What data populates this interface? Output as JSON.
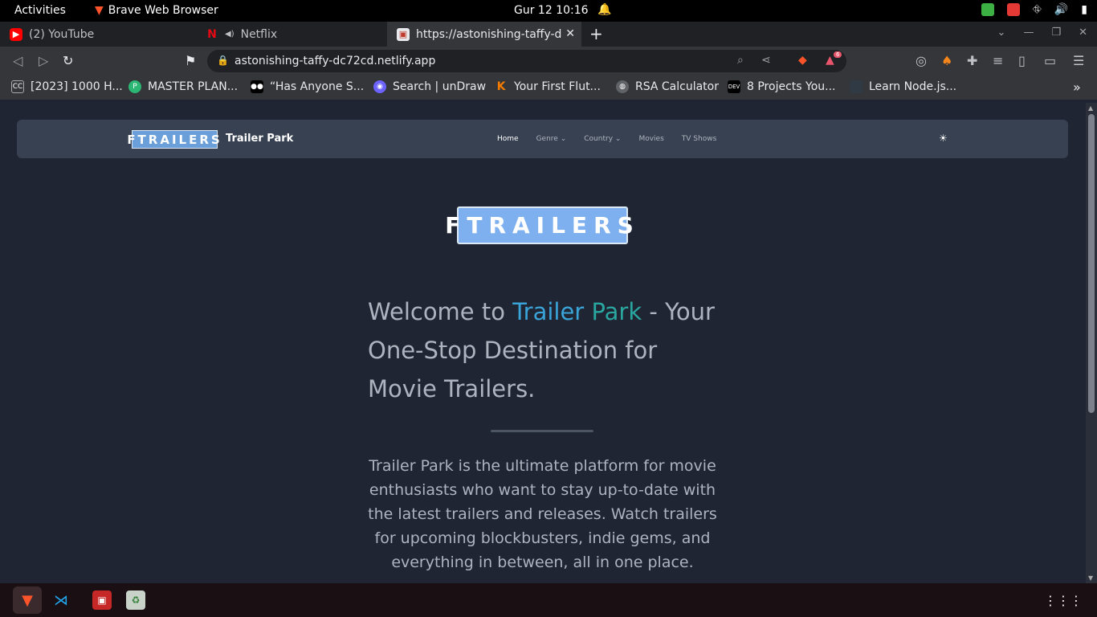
{
  "system": {
    "activities": "Activities",
    "app_name": "Brave Web Browser",
    "clock": "Gur 12  10:16"
  },
  "tabs": [
    {
      "label": "(2) YouTube"
    },
    {
      "label": "Netflix"
    },
    {
      "label": "https://astonishing-taffy-d"
    }
  ],
  "toolbar": {
    "url": "astonishing-taffy-dc72cd.netlify.app",
    "rewards_badge": "6"
  },
  "bookmarks": [
    {
      "label": "[2023] 1000 H..."
    },
    {
      "label": "MASTER PLAN..."
    },
    {
      "label": "“Has Anyone S..."
    },
    {
      "label": "Search | unDraw"
    },
    {
      "label": "Your First Flut..."
    },
    {
      "label": "RSA Calculator"
    },
    {
      "label": "8 Projects You..."
    },
    {
      "label": "Learn Node.js..."
    }
  ],
  "site": {
    "logo_text": "FTRAILERS",
    "brand": "Trailer Park",
    "nav": {
      "home": "Home",
      "genre": "Genre",
      "country": "Country",
      "movies": "Movies",
      "tv": "TV Shows"
    },
    "hero_logo": "FTRAILERS",
    "headline_pre": "Welcome to ",
    "headline_word1": "Trailer",
    "headline_word2": "Park",
    "headline_post": " - Your One-Stop Destination for Movie Trailers.",
    "description": "Trailer Park is the ultimate platform for movie enthusiasts who want to stay up-to-date with the latest trailers and releases. Watch trailers for upcoming blockbusters, indie gems, and everything in between, all in one place."
  },
  "colors": {
    "accent_blue": "#3aa3d8",
    "accent_teal": "#2aa6a0",
    "logo_blue": "#7eb0ef"
  }
}
